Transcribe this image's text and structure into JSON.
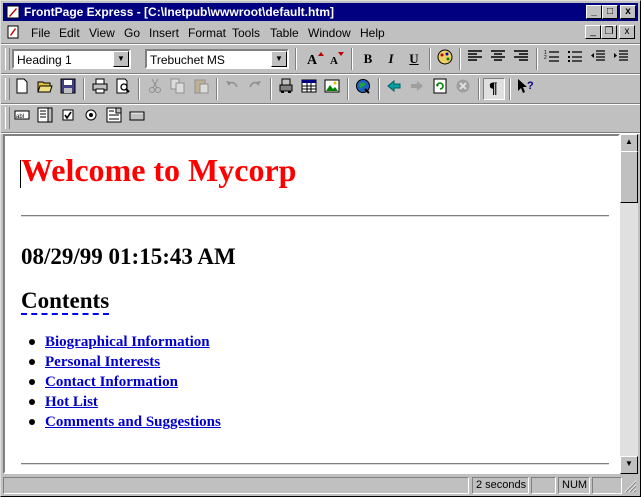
{
  "window": {
    "title": "FrontPage Express - [C:\\Inetpub\\wwwroot\\default.htm]",
    "minimize": "_",
    "maximize": "□",
    "close": "x"
  },
  "menu": {
    "items": [
      "File",
      "Edit",
      "View",
      "Go",
      "Insert",
      "Format",
      "Tools",
      "Table",
      "Window",
      "Help"
    ],
    "mdi_min": "_",
    "mdi_restore": "❐",
    "mdi_close": "x"
  },
  "format_toolbar": {
    "style_value": "Heading 1",
    "font_value": "Trebuchet MS",
    "bold": "B",
    "italic": "I",
    "underline": "U"
  },
  "document": {
    "heading": "Welcome to Mycorp",
    "datetime": "08/29/99 01:15:43 AM",
    "contents_heading": "Contents",
    "links": [
      "Biographical Information",
      "Personal Interests",
      "Contact Information",
      "Hot List",
      "Comments and Suggestions"
    ]
  },
  "status": {
    "time": "2 seconds",
    "num": "NUM"
  },
  "colors": {
    "titlebar": "#000080",
    "heading": "#ff0000",
    "link": "#0000cc"
  }
}
